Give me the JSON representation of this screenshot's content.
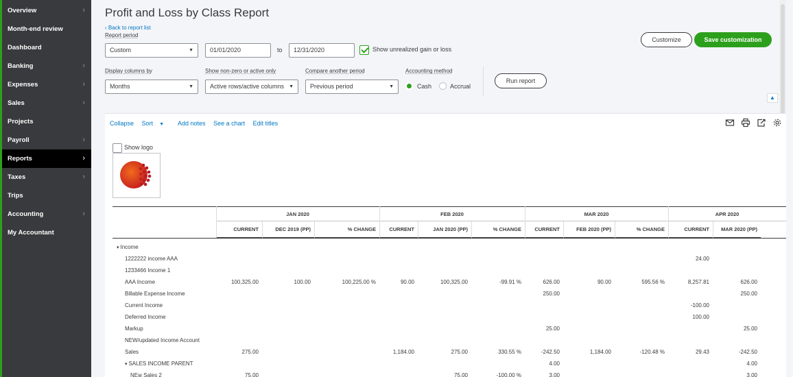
{
  "sidebar": {
    "items": [
      {
        "label": "Overview",
        "chevron": true,
        "active": false
      },
      {
        "label": "Month-end review",
        "chevron": false,
        "active": false
      },
      {
        "label": "Dashboard",
        "chevron": false,
        "active": false
      },
      {
        "label": "Banking",
        "chevron": true,
        "active": false
      },
      {
        "label": "Expenses",
        "chevron": true,
        "active": false
      },
      {
        "label": "Sales",
        "chevron": true,
        "active": false
      },
      {
        "label": "Projects",
        "chevron": false,
        "active": false
      },
      {
        "label": "Payroll",
        "chevron": true,
        "active": false
      },
      {
        "label": "Reports",
        "chevron": true,
        "active": true
      },
      {
        "label": "Taxes",
        "chevron": true,
        "active": false
      },
      {
        "label": "Trips",
        "chevron": false,
        "active": false
      },
      {
        "label": "Accounting",
        "chevron": true,
        "active": false
      },
      {
        "label": "My Accountant",
        "chevron": false,
        "active": false
      }
    ]
  },
  "header": {
    "title": "Profit and Loss by Class Report",
    "back_link": "Back to report list"
  },
  "filters": {
    "report_period_label": "Report period",
    "report_period_value": "Custom",
    "date_from": "01/01/2020",
    "to_label": "to",
    "date_to": "12/31/2020",
    "unrealized_label": "Show unrealized gain or loss",
    "unrealized_checked": true,
    "display_columns_label": "Display columns by",
    "display_columns_value": "Months",
    "non_zero_label": "Show non-zero or active only",
    "non_zero_value": "Active rows/active columns",
    "compare_label": "Compare another period",
    "compare_value": "Previous period",
    "accounting_method_label": "Accounting method",
    "method_cash": "Cash",
    "method_accrual": "Accrual",
    "selected_method": "Cash",
    "run_report": "Run report"
  },
  "actions": {
    "customize": "Customize",
    "save_customization": "Save customization"
  },
  "toolbar": {
    "collapse": "Collapse",
    "sort": "Sort",
    "add_notes": "Add notes",
    "see_chart": "See a chart",
    "edit_titles": "Edit titles",
    "icons": [
      "email-icon",
      "print-icon",
      "export-icon",
      "settings-icon"
    ]
  },
  "logo": {
    "show_logo_label": "Show logo",
    "checked": false
  },
  "table": {
    "months": [
      "JAN 2020",
      "FEB 2020",
      "MAR 2020",
      "APR 2020"
    ],
    "columns": [
      "CURRENT",
      "DEC 2019 (PP)",
      "% CHANGE",
      "CURRENT",
      "JAN 2020 (PP)",
      "% CHANGE",
      "CURRENT",
      "FEB 2020 (PP)",
      "% CHANGE",
      "CURRENT",
      "MAR 2020 (PP)"
    ],
    "rows": [
      {
        "name": "Income",
        "indent": 0,
        "caret": true,
        "values": [
          "",
          "",
          "",
          "",
          "",
          "",
          "",
          "",
          "",
          "",
          ""
        ]
      },
      {
        "name": "1222222 income AAA",
        "indent": 1,
        "caret": false,
        "values": [
          "",
          "",
          "",
          "",
          "",
          "",
          "",
          "",
          "",
          "24.00",
          ""
        ]
      },
      {
        "name": "1233466 Income 1",
        "indent": 1,
        "caret": false,
        "values": [
          "",
          "",
          "",
          "",
          "",
          "",
          "",
          "",
          "",
          "",
          ""
        ]
      },
      {
        "name": "AAA Income",
        "indent": 1,
        "caret": false,
        "values": [
          "100,325.00",
          "100.00",
          "100,225.00 %",
          "90.00",
          "100,325.00",
          "-99.91 %",
          "626.00",
          "90.00",
          "595.56 %",
          "8,257.81",
          "626.00"
        ]
      },
      {
        "name": "Billable Expense Income",
        "indent": 1,
        "caret": false,
        "values": [
          "",
          "",
          "",
          "",
          "",
          "",
          "250.00",
          "",
          "",
          "",
          "250.00"
        ]
      },
      {
        "name": "Current Income",
        "indent": 1,
        "caret": false,
        "values": [
          "",
          "",
          "",
          "",
          "",
          "",
          "",
          "",
          "",
          "-100.00",
          ""
        ]
      },
      {
        "name": "Deferred Income",
        "indent": 1,
        "caret": false,
        "values": [
          "",
          "",
          "",
          "",
          "",
          "",
          "",
          "",
          "",
          "100.00",
          ""
        ]
      },
      {
        "name": "Markup",
        "indent": 1,
        "caret": false,
        "values": [
          "",
          "",
          "",
          "",
          "",
          "",
          "25.00",
          "",
          "",
          "",
          "25.00"
        ]
      },
      {
        "name": "NEW/updated Income Account",
        "indent": 1,
        "caret": false,
        "values": [
          "",
          "",
          "",
          "",
          "",
          "",
          "",
          "",
          "",
          "",
          ""
        ]
      },
      {
        "name": "Sales",
        "indent": 1,
        "caret": false,
        "values": [
          "275.00",
          "",
          "",
          "1,184.00",
          "275.00",
          "330.55 %",
          "-242.50",
          "1,184.00",
          "-120.48 %",
          "29.43",
          "-242.50"
        ]
      },
      {
        "name": "SALES INCOME PARENT",
        "indent": 1,
        "caret": true,
        "values": [
          "",
          "",
          "",
          "",
          "",
          "",
          "4.00",
          "",
          "",
          "",
          "4.00"
        ]
      },
      {
        "name": "NEw Sales 2",
        "indent": 2,
        "caret": false,
        "values": [
          "75.00",
          "",
          "",
          "",
          "75.00",
          "-100.00 %",
          "3.00",
          "",
          "",
          "",
          "3.00"
        ]
      }
    ]
  }
}
